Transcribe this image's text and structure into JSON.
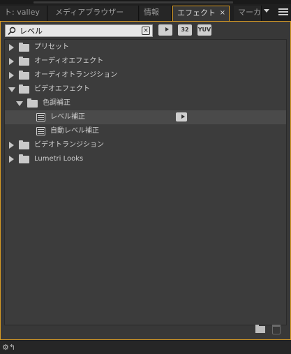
{
  "tabs": [
    {
      "label": "ト: valley"
    },
    {
      "label": "メディアブラウザー"
    },
    {
      "label": "情報"
    },
    {
      "label": "エフェクト"
    },
    {
      "label": "マーカ"
    }
  ],
  "search": {
    "value": "レベル",
    "clear_symbol": "×"
  },
  "filters": [
    {
      "label": "",
      "icon": "accelerated-effects-icon"
    },
    {
      "label": "32",
      "icon": "32bit-color-icon"
    },
    {
      "label": "YUV",
      "icon": "yuv-effects-icon"
    }
  ],
  "tree": [
    {
      "label": "プリセット",
      "type": "folder",
      "state": "collapsed",
      "level": 0
    },
    {
      "label": "オーディオエフェクト",
      "type": "folder",
      "state": "collapsed",
      "level": 0
    },
    {
      "label": "オーディオトランジション",
      "type": "folder",
      "state": "collapsed",
      "level": 0
    },
    {
      "label": "ビデオエフェクト",
      "type": "folder",
      "state": "expanded",
      "level": 0
    },
    {
      "label": "色調補正",
      "type": "folder",
      "state": "expanded",
      "level": 1
    },
    {
      "label": "レベル補正",
      "type": "effect",
      "level": 2,
      "selected": true,
      "accelerated": true
    },
    {
      "label": "自動レベル補正",
      "type": "effect",
      "level": 2
    },
    {
      "label": "ビデオトランジション",
      "type": "folder",
      "state": "collapsed",
      "level": 0
    },
    {
      "label": "Lumetri Looks",
      "type": "folder",
      "state": "collapsed",
      "level": 0
    }
  ],
  "colors": {
    "accent": "#d79a24",
    "panel_bg": "#383838",
    "tree_bg": "#3c3c3c",
    "text": "#cfcfcf"
  }
}
